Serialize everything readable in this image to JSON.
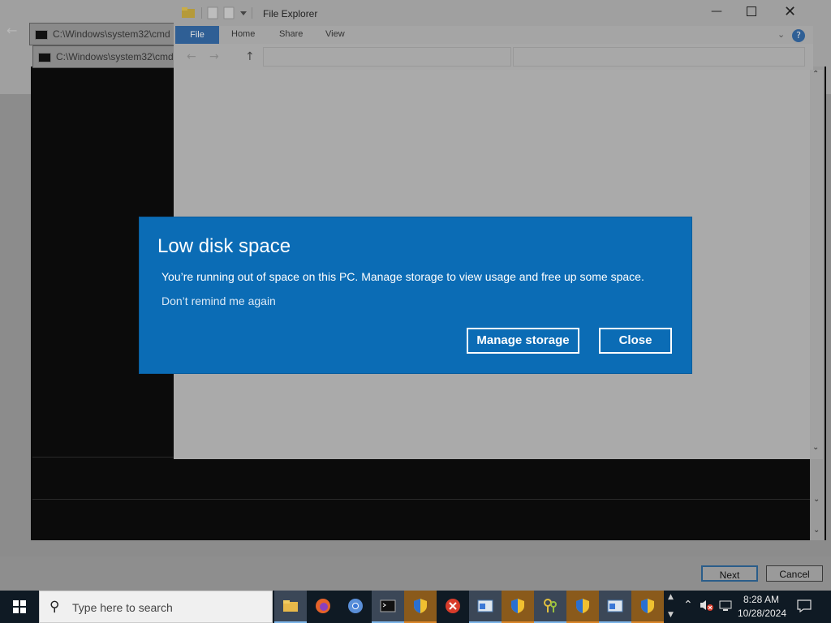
{
  "cmd_windows": [
    {
      "title": "C:\\Windows\\system32\\cmd"
    },
    {
      "title": "C:\\Windows\\system32\\cmd"
    }
  ],
  "file_explorer": {
    "title": "File Explorer",
    "tabs": [
      "File",
      "Home",
      "Share",
      "View"
    ],
    "help": "?"
  },
  "dialog": {
    "title": "Low disk space",
    "message": "You’re running out of space on this PC. Manage storage to view usage and free up some space.",
    "remind_link": "Don’t remind me again",
    "manage_button": "Manage storage",
    "close_button": "Close",
    "background_color": "#0b6cb5"
  },
  "wizard": {
    "next_button": "Next",
    "cancel_button": "Cancel"
  },
  "taskbar": {
    "search_placeholder": "Type here to search",
    "apps": [
      "file-explorer-icon",
      "firefox-icon",
      "chrome-icon",
      "terminal-icon",
      "shield-icon",
      "error-icon",
      "window-icon",
      "shield-icon",
      "keys-icon",
      "shield-icon",
      "window-icon",
      "shield-icon"
    ],
    "clock_time": "8:28 AM",
    "clock_date": "10/28/2024"
  }
}
